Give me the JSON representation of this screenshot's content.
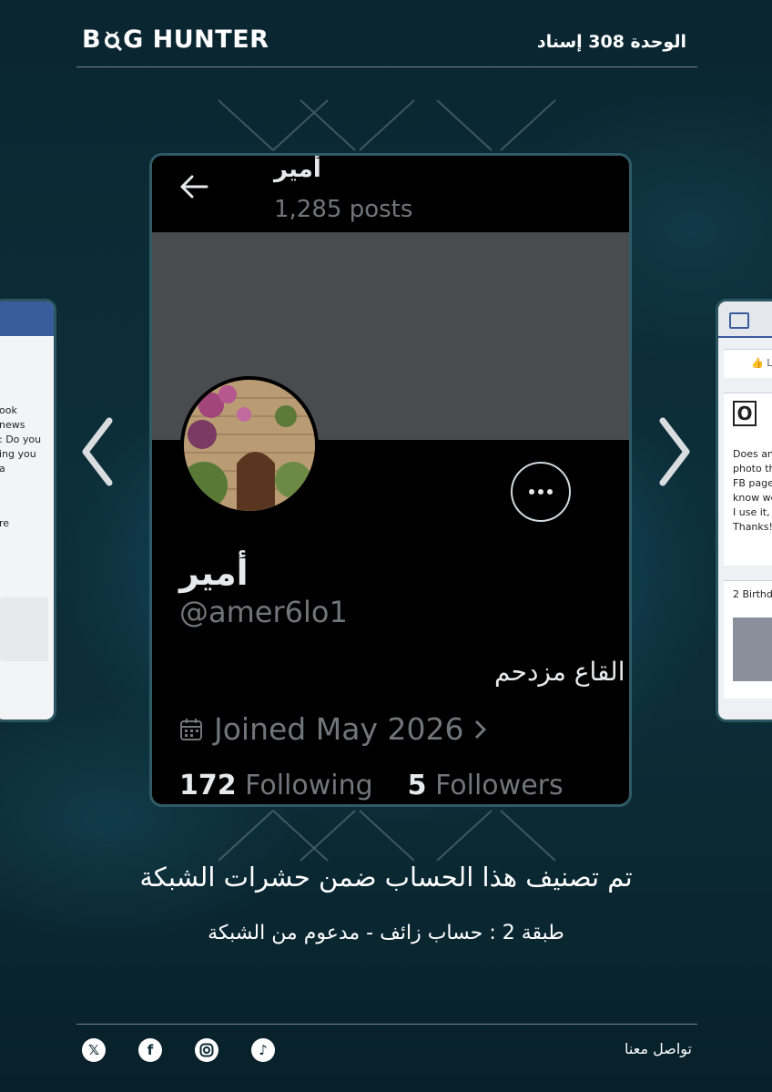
{
  "header": {
    "logo_left": "B",
    "logo_right": "G HUNTER",
    "unit_label": "الوحدة 308 إسناد"
  },
  "profile": {
    "top_name": "أمير",
    "posts_count": "1,285 posts",
    "display_name": "أمير",
    "handle": "@amer6lo1",
    "bio": "القاع مزدحم",
    "joined": "Joined May 2026",
    "following_count": "172",
    "following_label": "Following",
    "followers_count": "5",
    "followers_label": "Followers"
  },
  "side_left": {
    "lines": [
      "ook",
      "news",
      ": Do you",
      "ing you",
      "a",
      "",
      "",
      "re"
    ]
  },
  "side_right": {
    "lines": [
      "Does an",
      "photo th",
      "FB page",
      "know we",
      "I use it, j",
      "Thanks!"
    ],
    "birthdays": "2 Birthd"
  },
  "captions": {
    "main": "تم تصنيف هذا الحساب ضمن حشرات الشبكة",
    "sub": "طبقة 2 : حساب زائف - مدعوم من الشبكة"
  },
  "footer": {
    "contact_label": "تواصل معنا",
    "social_icons": [
      "x-icon",
      "facebook-icon",
      "instagram-icon",
      "tiktok-icon"
    ]
  }
}
